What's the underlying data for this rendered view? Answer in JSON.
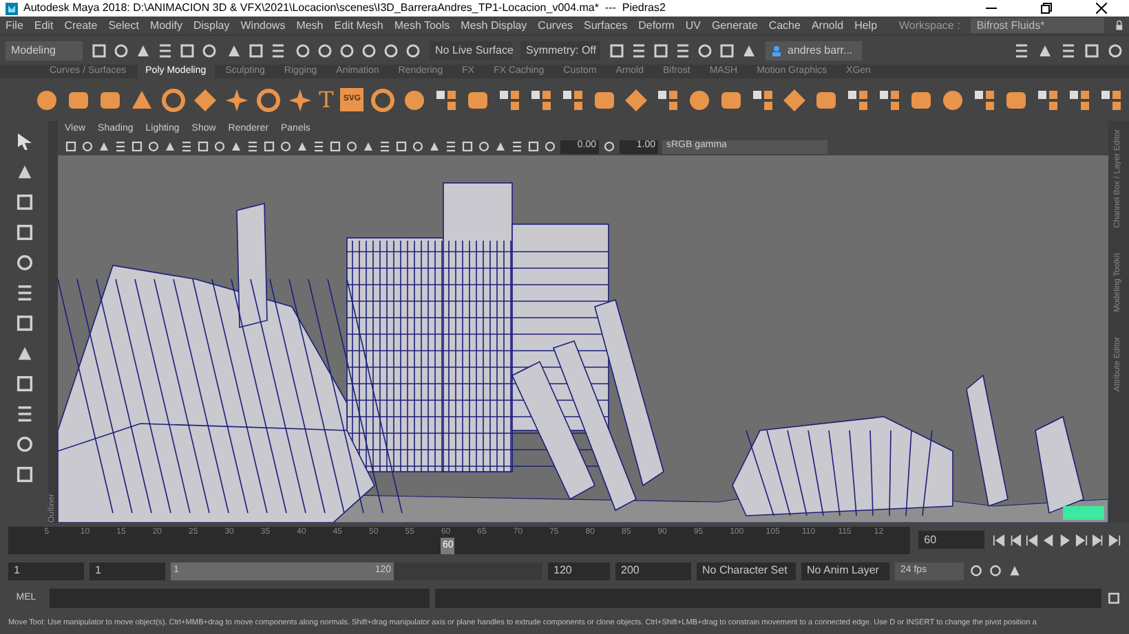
{
  "window": {
    "title": "Autodesk Maya 2018: D:\\ANIMACION 3D & VFX\\2021\\Locacion\\scenes\\I3D_BarreraAndres_TP1-Locacion_v004.ma*  ---  Piedras2"
  },
  "menu": [
    "File",
    "Edit",
    "Create",
    "Select",
    "Modify",
    "Display",
    "Windows",
    "Mesh",
    "Edit Mesh",
    "Mesh Tools",
    "Mesh Display",
    "Curves",
    "Surfaces",
    "Deform",
    "UV",
    "Generate",
    "Cache",
    "Arnold",
    "Help"
  ],
  "workspace": {
    "label": "Workspace :",
    "value": "Bifrost Fluids*"
  },
  "status_line": {
    "menu_set": "Modeling",
    "live_surface": "No Live Surface",
    "symmetry": "Symmetry: Off",
    "user": "andres barr..."
  },
  "shelf_tabs": [
    {
      "label": "Curves / Surfaces",
      "selected": false
    },
    {
      "label": "Poly Modeling",
      "selected": true
    },
    {
      "label": "Sculpting",
      "selected": false
    },
    {
      "label": "Rigging",
      "selected": false
    },
    {
      "label": "Animation",
      "selected": false
    },
    {
      "label": "Rendering",
      "selected": false
    },
    {
      "label": "FX",
      "selected": false
    },
    {
      "label": "FX Caching",
      "selected": false
    },
    {
      "label": "Custom",
      "selected": false
    },
    {
      "label": "Arnold",
      "selected": false
    },
    {
      "label": "Bifrost",
      "selected": false
    },
    {
      "label": "MASH",
      "selected": false
    },
    {
      "label": "Motion Graphics",
      "selected": false
    },
    {
      "label": "XGen",
      "selected": false
    }
  ],
  "shelf_text_tools": [
    "T",
    "SVG"
  ],
  "panel_menu": [
    "View",
    "Shading",
    "Lighting",
    "Show",
    "Renderer",
    "Panels"
  ],
  "panel_toolbar": {
    "exposure": "0.00",
    "gamma": "1.00",
    "color_space": "sRGB gamma"
  },
  "left_tab": "Outliner",
  "right_tabs": [
    "Channel Box / Layer Editor",
    "Modeling Toolkit",
    "Attribute Editor"
  ],
  "time_slider": {
    "ticks": [
      "5",
      "10",
      "15",
      "20",
      "25",
      "30",
      "35",
      "40",
      "45",
      "50",
      "55",
      "60",
      "65",
      "70",
      "75",
      "80",
      "85",
      "90",
      "95",
      "100",
      "105",
      "110",
      "115",
      "12"
    ],
    "playhead": {
      "label": "60",
      "level": 0.5
    },
    "current_frame": "60"
  },
  "range": {
    "start": "1",
    "playback_start": "1",
    "slider_start": "1",
    "slider_end": "120",
    "level": 0.6,
    "playback_end": "120",
    "end": "200",
    "character_set": "No Character Set",
    "anim_layer": "No Anim Layer",
    "fps": "24 fps"
  },
  "command_line": {
    "label": "MEL"
  },
  "help_line": "Move Tool: Use manipulator to move object(s). Ctrl+MMB+drag to move components along normals. Shift+drag manipulator axis or plane handles to extrude components or clone objects. Ctrl+Shift+LMB+drag to constrain movement to a connected edge. Use D or INSERT to change the pivot position a"
}
